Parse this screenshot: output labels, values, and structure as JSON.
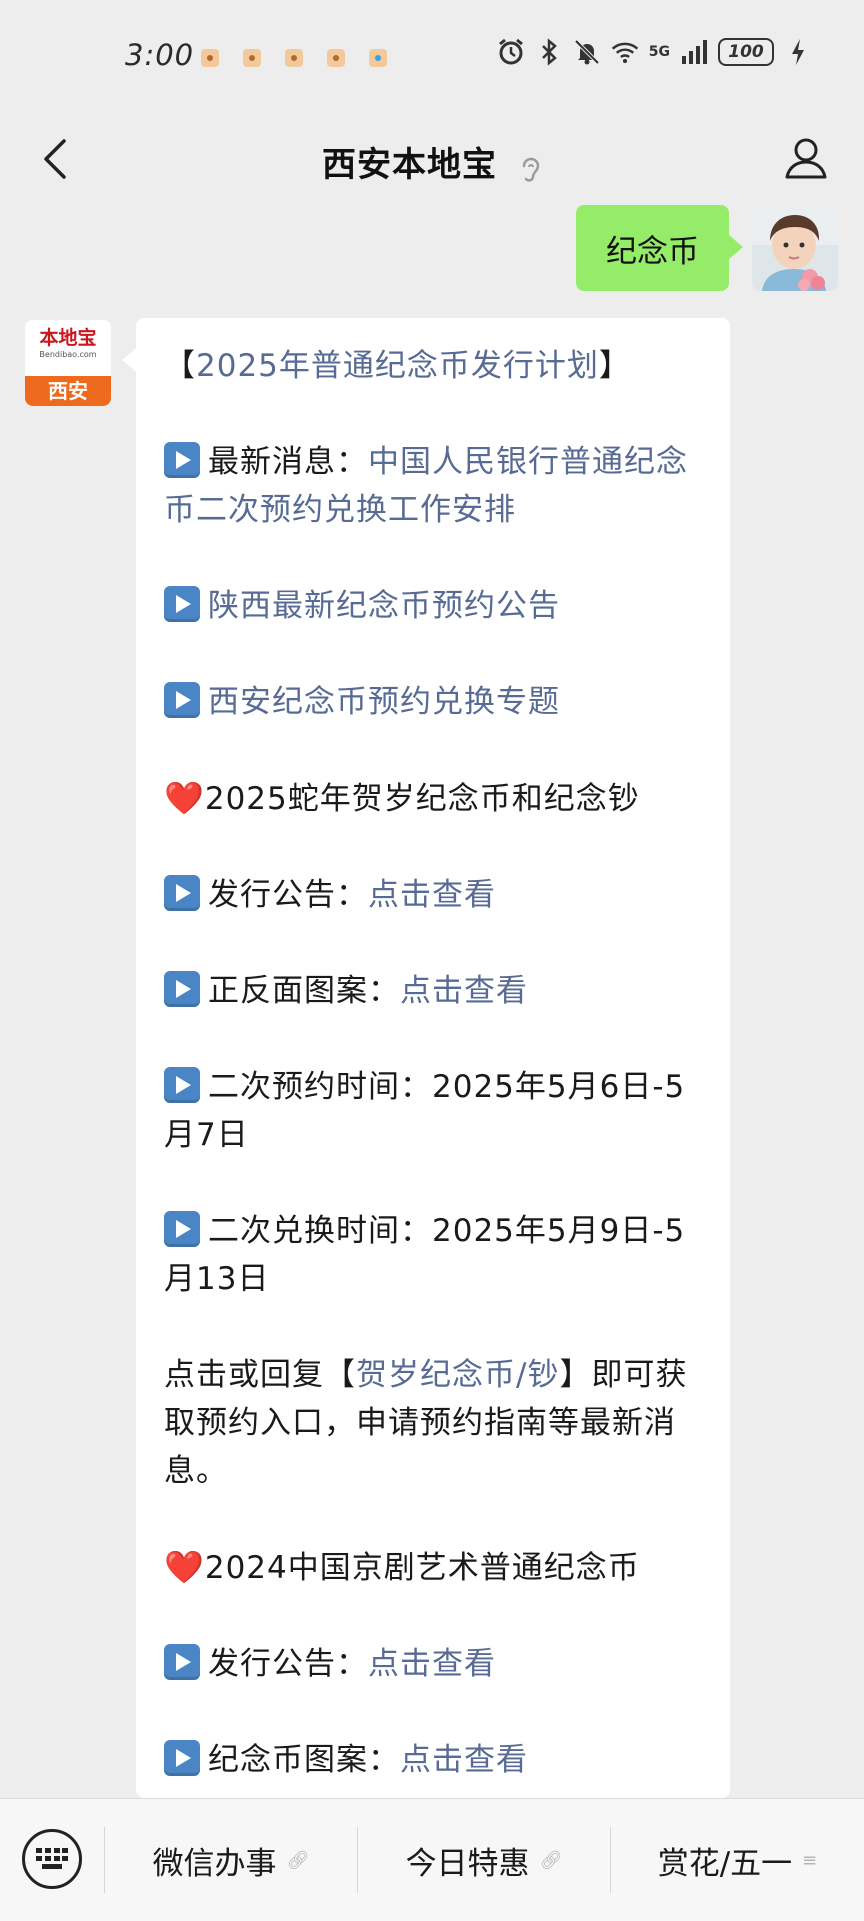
{
  "status_bar": {
    "time": "3:00",
    "network": "5G",
    "battery": "100"
  },
  "header": {
    "title": "西安本地宝"
  },
  "sent_message": {
    "text": "纪念币"
  },
  "bot": {
    "avatar_brand": "本地宝",
    "avatar_url": "Bendibao.com",
    "avatar_city": "西安"
  },
  "reply": {
    "title_open": "【",
    "title_link": "2025年普通纪念币发行计划",
    "title_close": "】",
    "latest_label": "最新消息：",
    "latest_link": "中国人民银行普通纪念币二次预约兑换工作安排",
    "shaanxi_link": "陕西最新纪念币预约公告",
    "xian_link": "西安纪念币预约兑换专题",
    "heart1": "❤️",
    "snake_heading": "2025蛇年贺岁纪念币和纪念钞",
    "issue_label1": "发行公告：",
    "issue_link1": "点击查看",
    "pattern_label1": "正反面图案：",
    "pattern_link1": "点击查看",
    "reserve_time": "二次预约时间：2025年5月6日-5月7日",
    "exchange_time": "二次兑换时间：2025年5月9日-5月13日",
    "reply_prefix": "点击或回复【",
    "reply_link": "贺岁纪念币/钞",
    "reply_suffix": "】即可获取预约入口，申请预约指南等最新消息。",
    "heart2": "❤️",
    "opera_heading": "2024中国京剧艺术普通纪念币",
    "issue_label2": "发行公告：",
    "issue_link2": "点击查看",
    "pattern_label2": "纪念币图案：",
    "pattern_link2": "点击查看"
  },
  "bottom_menu": {
    "item1": "微信办事",
    "item2": "今日特惠",
    "item3": "赏花/五一"
  },
  "colors": {
    "link": "#576b95",
    "sent_bubble": "#95ec69",
    "background": "#ededed"
  }
}
